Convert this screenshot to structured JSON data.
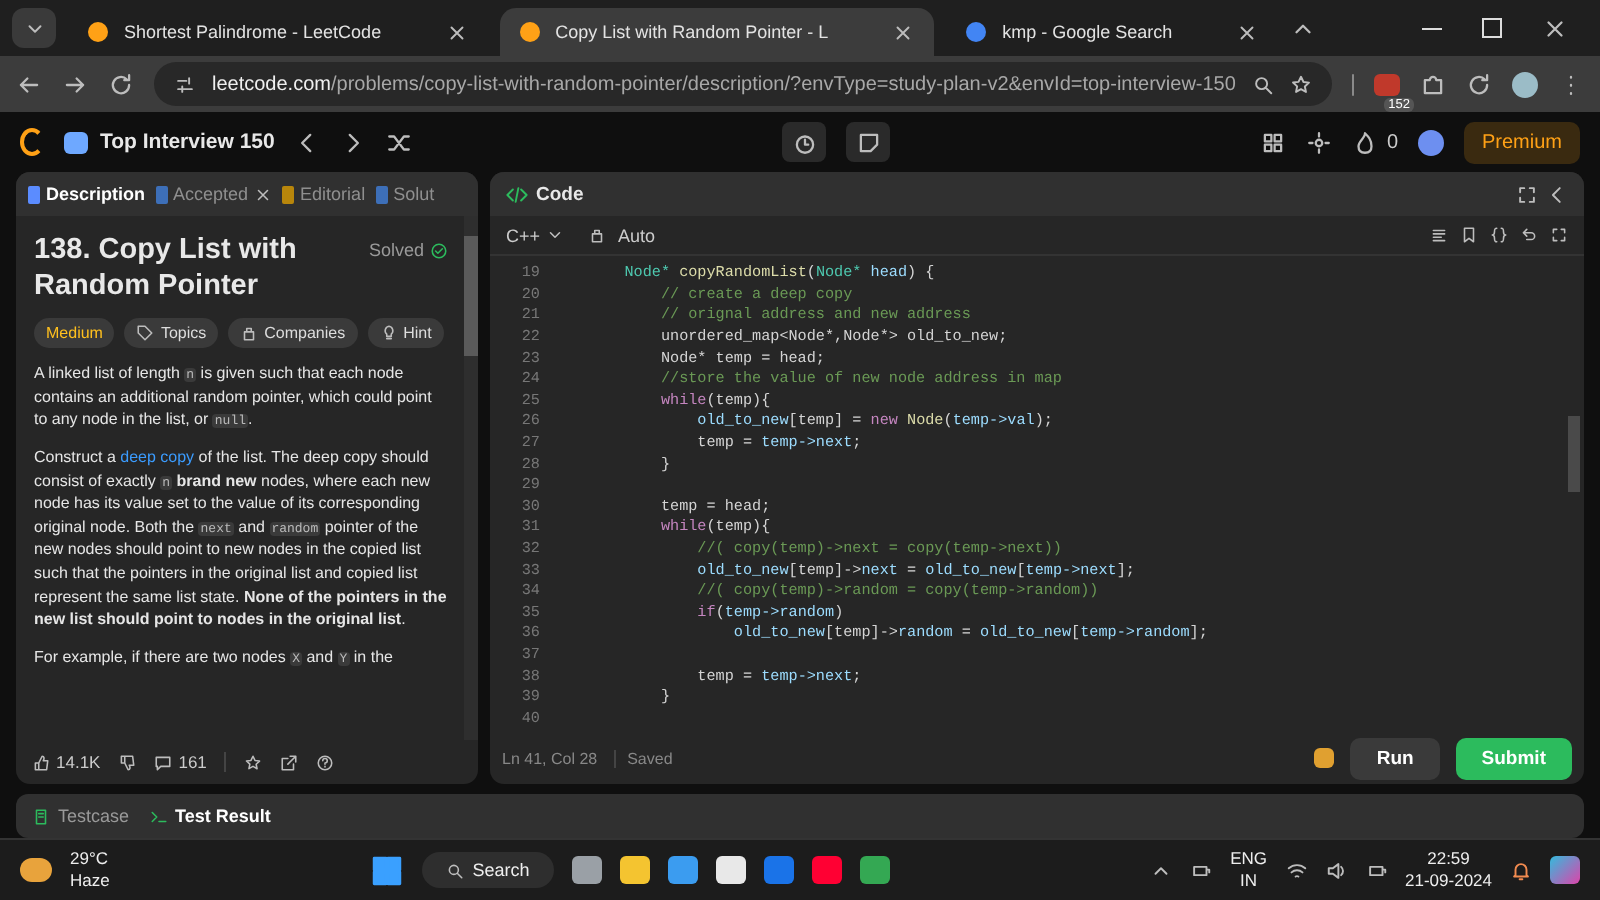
{
  "browser": {
    "tabs": [
      {
        "title": "Shortest Palindrome - LeetCode",
        "selected": false
      },
      {
        "title": "Copy List with Random Pointer - L",
        "selected": true
      },
      {
        "title": "kmp - Google Search",
        "selected": false
      }
    ],
    "address": {
      "host": "leetcode.com",
      "path": "/problems/copy-list-with-random-pointer/description/?envType=study-plan-v2&envId=top-interview-150"
    },
    "extension_badge": "152"
  },
  "header": {
    "study_plan": "Top Interview 150",
    "streak": "0",
    "premium": "Premium"
  },
  "left_tabs": [
    {
      "label": "Description",
      "selected": true,
      "closable": false
    },
    {
      "label": "Accepted",
      "selected": false,
      "closable": true
    },
    {
      "label": "Editorial",
      "selected": false,
      "closable": false
    },
    {
      "label": "Solut",
      "selected": false,
      "closable": false
    }
  ],
  "problem": {
    "title": "138. Copy List with Random Pointer",
    "status": "Solved",
    "difficulty": "Medium",
    "tags": [
      {
        "kind": "topics",
        "label": "Topics"
      },
      {
        "kind": "companies",
        "label": "Companies"
      },
      {
        "kind": "hint",
        "label": "Hint"
      }
    ],
    "paragraphs": [
      [
        {
          "kind": "text",
          "text": "A linked list of length "
        },
        {
          "kind": "code",
          "text": "n"
        },
        {
          "kind": "text",
          "text": " is given such that each node contains an additional random pointer, which could point to any node in the list, or "
        },
        {
          "kind": "code",
          "text": "null"
        },
        {
          "kind": "text",
          "text": "."
        }
      ],
      [
        {
          "kind": "text",
          "text": "Construct a "
        },
        {
          "kind": "link",
          "text": "deep copy"
        },
        {
          "kind": "text",
          "text": " of the list. The deep copy should consist of exactly "
        },
        {
          "kind": "code",
          "text": "n"
        },
        {
          "kind": "bold",
          "text": " brand new"
        },
        {
          "kind": "text",
          "text": " nodes, where each new node has its value set to the value of its corresponding original node. Both the "
        },
        {
          "kind": "code",
          "text": "next"
        },
        {
          "kind": "text",
          "text": " and "
        },
        {
          "kind": "code",
          "text": "random"
        },
        {
          "kind": "text",
          "text": " pointer of the new nodes should point to new nodes in the copied list such that the pointers in the original list and copied list represent the same list state. "
        },
        {
          "kind": "bold",
          "text": "None of the pointers in the new list should point to nodes in the original list"
        },
        {
          "kind": "text",
          "text": "."
        }
      ],
      [
        {
          "kind": "text",
          "text": "For example, if there are two nodes "
        },
        {
          "kind": "code",
          "text": "X"
        },
        {
          "kind": "text",
          "text": " and "
        },
        {
          "kind": "code",
          "text": "Y"
        },
        {
          "kind": "text",
          "text": " in the"
        }
      ]
    ],
    "likes": "14.1K",
    "comments": "161"
  },
  "editor": {
    "title": "Code",
    "language": "C++",
    "mode": "Auto",
    "lines": [
      {
        "number": "19",
        "tokens": [
          {
            "kind": "type",
            "text": "    Node*"
          },
          {
            "kind": "fn",
            "text": " copyRandomList"
          },
          {
            "kind": "plain",
            "text": "("
          },
          {
            "kind": "type",
            "text": "Node*"
          },
          {
            "kind": "var",
            "text": " head"
          },
          {
            "kind": "plain",
            "text": ") {"
          }
        ]
      },
      {
        "number": "20",
        "tokens": [
          {
            "kind": "comment",
            "text": "        // create a deep copy"
          }
        ]
      },
      {
        "number": "21",
        "tokens": [
          {
            "kind": "comment",
            "text": "        // orignal address and new address"
          }
        ]
      },
      {
        "number": "22",
        "tokens": [
          {
            "kind": "plain",
            "text": "        unordered_map<Node*,Node*> old_to_new;"
          }
        ]
      },
      {
        "number": "23",
        "tokens": [
          {
            "kind": "plain",
            "text": "        Node* temp = head;"
          }
        ]
      },
      {
        "number": "24",
        "tokens": [
          {
            "kind": "comment",
            "text": "        //store the value of new node address in map"
          }
        ]
      },
      {
        "number": "25",
        "tokens": [
          {
            "kind": "kw",
            "text": "        while"
          },
          {
            "kind": "plain",
            "text": "(temp){"
          }
        ]
      },
      {
        "number": "26",
        "tokens": [
          {
            "kind": "var",
            "text": "            old_to_new"
          },
          {
            "kind": "plain",
            "text": "[temp] = "
          },
          {
            "kind": "kw",
            "text": "new"
          },
          {
            "kind": "fn",
            "text": " Node"
          },
          {
            "kind": "plain",
            "text": "("
          },
          {
            "kind": "var",
            "text": "temp->val"
          },
          {
            "kind": "plain",
            "text": ");"
          }
        ]
      },
      {
        "number": "27",
        "tokens": [
          {
            "kind": "plain",
            "text": "            temp = "
          },
          {
            "kind": "var",
            "text": "temp->next"
          },
          {
            "kind": "plain",
            "text": ";"
          }
        ]
      },
      {
        "number": "28",
        "tokens": [
          {
            "kind": "plain",
            "text": "        }"
          }
        ]
      },
      {
        "number": "29"
      },
      {
        "number": "30",
        "tokens": [
          {
            "kind": "plain",
            "text": "        temp = head;"
          }
        ]
      },
      {
        "number": "31",
        "tokens": [
          {
            "kind": "kw",
            "text": "        while"
          },
          {
            "kind": "plain",
            "text": "(temp){"
          }
        ]
      },
      {
        "number": "32",
        "tokens": [
          {
            "kind": "comment",
            "text": "            //( copy(temp)->next = copy(temp->next))"
          }
        ]
      },
      {
        "number": "33",
        "tokens": [
          {
            "kind": "var",
            "text": "            old_to_new"
          },
          {
            "kind": "plain",
            "text": "[temp]->"
          },
          {
            "kind": "var",
            "text": "next"
          },
          {
            "kind": "plain",
            "text": " = "
          },
          {
            "kind": "var",
            "text": "old_to_new"
          },
          {
            "kind": "plain",
            "text": "["
          },
          {
            "kind": "var",
            "text": "temp->next"
          },
          {
            "kind": "plain",
            "text": "];"
          }
        ]
      },
      {
        "number": "34",
        "tokens": [
          {
            "kind": "comment",
            "text": "            //( copy(temp)->random = copy(temp->random))"
          }
        ]
      },
      {
        "number": "35",
        "tokens": [
          {
            "kind": "kw",
            "text": "            if"
          },
          {
            "kind": "plain",
            "text": "("
          },
          {
            "kind": "var",
            "text": "temp->random"
          },
          {
            "kind": "plain",
            "text": ")"
          }
        ]
      },
      {
        "number": "36",
        "tokens": [
          {
            "kind": "var",
            "text": "                old_to_new"
          },
          {
            "kind": "plain",
            "text": "[temp]->"
          },
          {
            "kind": "var",
            "text": "random"
          },
          {
            "kind": "plain",
            "text": " = "
          },
          {
            "kind": "var",
            "text": "old_to_new"
          },
          {
            "kind": "plain",
            "text": "["
          },
          {
            "kind": "var",
            "text": "temp->random"
          },
          {
            "kind": "plain",
            "text": "];"
          }
        ]
      },
      {
        "number": "37"
      },
      {
        "number": "38",
        "tokens": [
          {
            "kind": "plain",
            "text": "            temp = "
          },
          {
            "kind": "var",
            "text": "temp->next"
          },
          {
            "kind": "plain",
            "text": ";"
          }
        ]
      },
      {
        "number": "39",
        "tokens": [
          {
            "kind": "plain",
            "text": "        }"
          }
        ]
      },
      {
        "number": "40"
      }
    ],
    "cursor": "Ln 41, Col 28",
    "saved": "Saved",
    "run": "Run",
    "submit": "Submit"
  },
  "console_tabs": [
    {
      "label": "Testcase",
      "selected": false
    },
    {
      "label": "Test Result",
      "selected": true
    }
  ],
  "taskbar": {
    "temperature": "29°C",
    "condition": "Haze",
    "search": "Search",
    "lang": "ENG",
    "region": "IN",
    "time": "22:59",
    "date": "21-09-2024"
  }
}
